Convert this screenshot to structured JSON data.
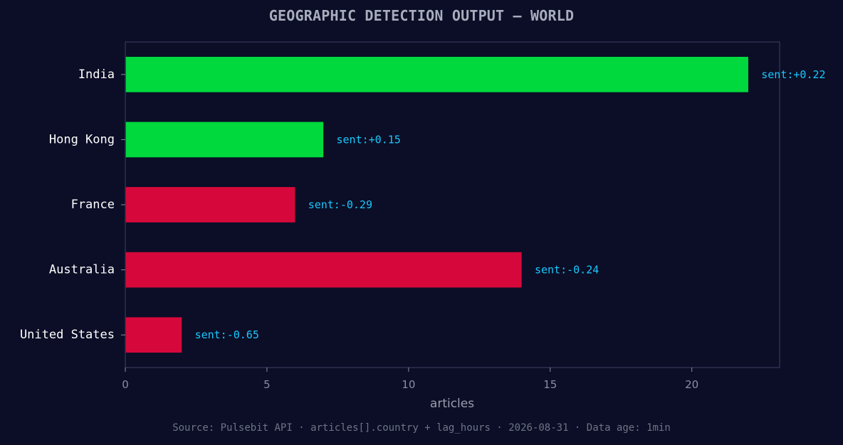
{
  "chart_data": {
    "type": "bar",
    "orientation": "horizontal",
    "title": "GEOGRAPHIC DETECTION OUTPUT — WORLD",
    "xlabel": "articles",
    "ylabel": "",
    "categories": [
      "India",
      "Hong Kong",
      "France",
      "Australia",
      "United States"
    ],
    "values": [
      22,
      7,
      6,
      14,
      2
    ],
    "annotations": [
      "sent:+0.22",
      "sent:+0.15",
      "sent:-0.29",
      "sent:-0.24",
      "sent:-0.65"
    ],
    "sentiment": [
      0.22,
      0.15,
      -0.29,
      -0.24,
      -0.65
    ],
    "xlim": [
      0,
      23.1
    ],
    "xticks": [
      0,
      5,
      10,
      15,
      20
    ],
    "grid": false,
    "legend": "none"
  },
  "colors": {
    "background": "#0b0e26",
    "positive_bar": "#00d93e",
    "negative_bar": "#d6083b",
    "annotation": "#1ac8ff",
    "axis": "#2c3150",
    "category_label": "#ffffff",
    "tick_label": "#8a8ea0",
    "title": "#a8adbd"
  },
  "source_note": "Source: Pulsebit API · articles[].country + lag_hours · 2026-08-31 · Data age: 1min"
}
